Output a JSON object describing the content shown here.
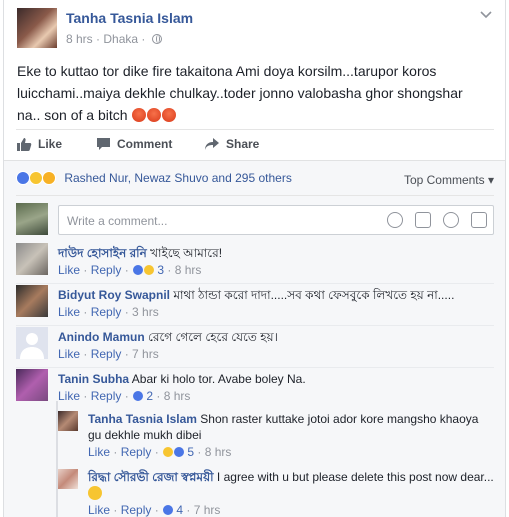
{
  "post": {
    "author": "Tanha Tasnia Islam",
    "time": "8 hrs",
    "location": "Dhaka",
    "text": "Eke to kuttao tor dike fire takaitona Ami doya korsilm...tarupor koros luicchami..maiya dekhle chulkay..toder jonno valobasha ghor shongshar na.. son of a bitch",
    "emoji_icons": [
      "angry-face-icon",
      "angry-face-icon",
      "angry-face-icon"
    ]
  },
  "actions": {
    "like": "Like",
    "comment": "Comment",
    "share": "Share"
  },
  "reactions": {
    "summary": "Rashed Nur, Newaz Shuvo and 295 others",
    "sort_label": "Top Comments",
    "icons": [
      "like-reaction-icon",
      "haha-reaction-icon",
      "wow-reaction-icon"
    ]
  },
  "composer": {
    "placeholder": "Write a comment..."
  },
  "comments": [
    {
      "name": "দাউদ হোসাইন রনি",
      "text": "খাইছে আমারে!",
      "like": "Like",
      "reply": "Reply",
      "count": "3",
      "time": "8 hrs"
    },
    {
      "name": "Bidyut Roy Swapnil",
      "text": "মাথা ঠান্ডা করো দাদা.....সব কথা ফেসবুকে লিখতে হয় না.....",
      "like": "Like",
      "reply": "Reply",
      "time": "3 hrs"
    },
    {
      "name": "Anindo Mamun",
      "text": "রেগে গেলে হেরে যেতে হয়।",
      "like": "Like",
      "reply": "Reply",
      "time": "7 hrs"
    },
    {
      "name": "Tanin Subha",
      "text": "Abar ki holo tor. Avabe boley Na.",
      "like": "Like",
      "reply": "Reply",
      "count": "2",
      "time": "8 hrs"
    }
  ],
  "replies": [
    {
      "name": "Tanha Tasnia Islam",
      "text": "Shon raster kuttake jotoi ador kore mangsho khaoya gu dekhle mukh dibei",
      "like": "Like",
      "reply": "Reply",
      "count": "5",
      "time": "8 hrs"
    },
    {
      "name": "রিদ্ধা সৌরভী রেজা স্বপ্নময়ী",
      "text": "I agree with u but please delete this post now dear...",
      "like": "Like",
      "reply": "Reply",
      "count": "4",
      "time": "7 hrs"
    }
  ],
  "colors": {
    "link": "#365899",
    "meta": "#90949c",
    "bg": "#f6f7f9",
    "like_blue": "#4a76e6"
  }
}
